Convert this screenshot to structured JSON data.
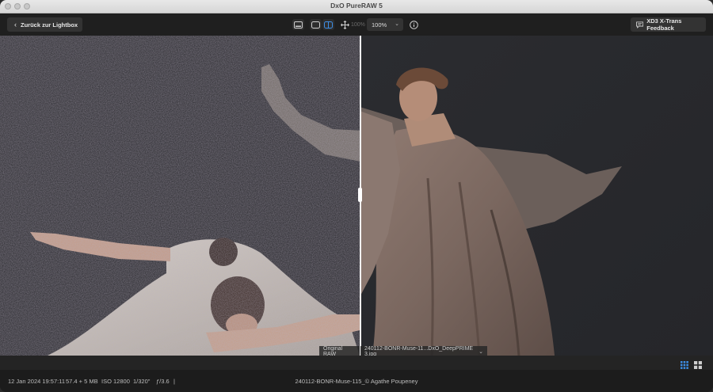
{
  "app": {
    "title": "DxO PureRAW 5"
  },
  "toolbar": {
    "back_label": "Zurück zur Lightbox",
    "zoom_dim": "100%",
    "zoom_value": "100%",
    "feedback_label": "XD3 X-Trans Feedback"
  },
  "viewer": {
    "left_label": "Original RAW",
    "right_label": "240112-BONR-Muse-11...DxO_DeepPRIME 3.jpg"
  },
  "status": {
    "date": "12 Jan 2024 19:57:11",
    "size": "57.4 + 5 MB",
    "iso": "ISO 12800",
    "shutter": "1/320\"",
    "aperture": "ƒ/3.6",
    "separator": "|",
    "caption": "240112-BONR-Muse-115_© Agathe Poupeney"
  },
  "colors": {
    "accent": "#3d8ee6",
    "background": "#1e1e1e"
  }
}
